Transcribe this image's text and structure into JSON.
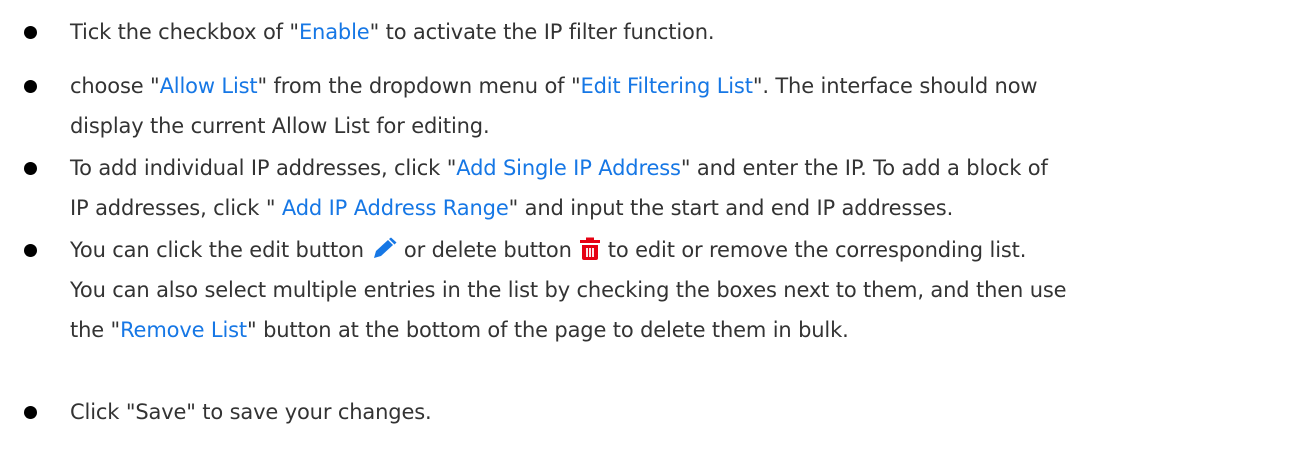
{
  "colors": {
    "text": "#333333",
    "highlight": "#1677e5",
    "bullet": "#000000",
    "edit_icon": "#1677e5",
    "delete_icon": "#e60012"
  },
  "items": [
    {
      "lines": [
        [
          {
            "t": "Tick the checkbox of \""
          },
          {
            "t": "Enable",
            "hl": true
          },
          {
            "t": "\" to activate the IP filter function."
          }
        ]
      ]
    },
    {
      "lines": [
        [
          {
            "t": "choose \""
          },
          {
            "t": "Allow List",
            "hl": true
          },
          {
            "t": "\" from the dropdown menu of \""
          },
          {
            "t": "Edit Filtering List",
            "hl": true
          },
          {
            "t": "\". The interface should now"
          }
        ],
        [
          {
            "t": "display the current Allow List for editing."
          }
        ]
      ]
    },
    {
      "lines": [
        [
          {
            "t": "To add individual IP addresses, click \""
          },
          {
            "t": "Add Single IP Address",
            "hl": true
          },
          {
            "t": "\" and enter the IP. To add a block of"
          }
        ],
        [
          {
            "t": "IP addresses, click \" "
          },
          {
            "t": "Add IP Address Range",
            "hl": true
          },
          {
            "t": "\" and input the start and end IP addresses."
          }
        ]
      ]
    },
    {
      "lines": [
        [
          {
            "t": "You can click the edit button"
          },
          {
            "icon": "pencil-icon"
          },
          {
            "t": "or delete button"
          },
          {
            "icon": "trash-icon"
          },
          {
            "t": "to edit or remove the corresponding list."
          }
        ],
        [
          {
            "t": "You can also select multiple entries in the list by checking the boxes next to them, and then use"
          }
        ],
        [
          {
            "t": "the \""
          },
          {
            "t": "Remove List",
            "hl": true
          },
          {
            "t": "\" button at the bottom of the page to delete them in bulk."
          }
        ]
      ]
    },
    {
      "lines": [
        [
          {
            "t": "Click \"Save\" to save your changes."
          }
        ]
      ]
    }
  ]
}
